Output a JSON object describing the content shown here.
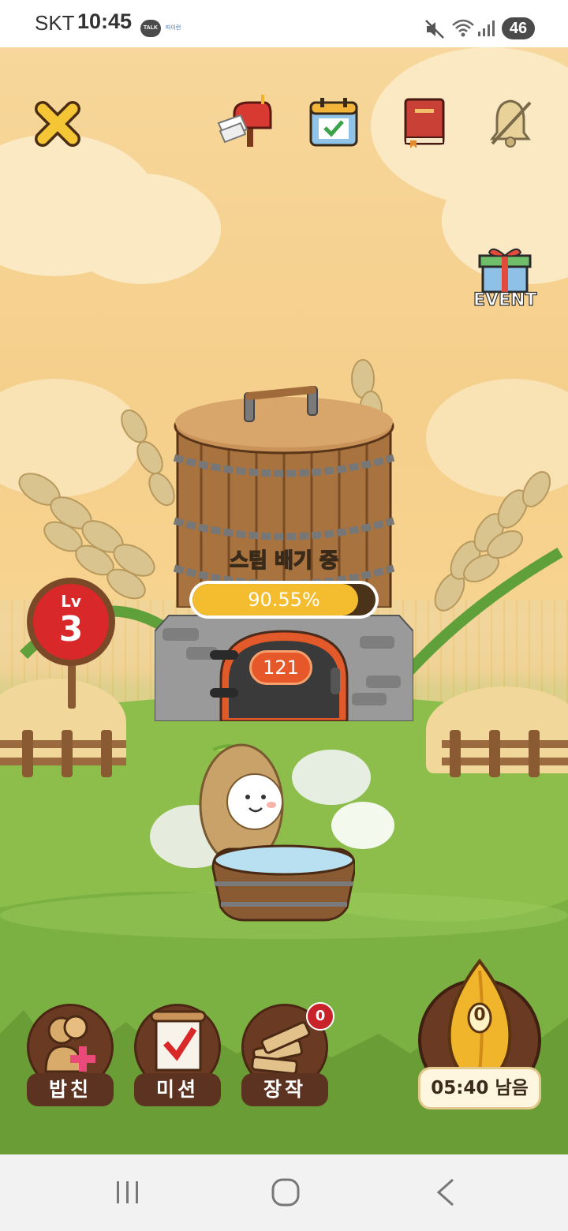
{
  "status_bar": {
    "carrier": "SKT",
    "time": "10:45",
    "talk_badge": "TALK",
    "talk_small": "따이런",
    "battery": "46"
  },
  "game": {
    "event_label": "EVENT",
    "level_prefix": "Lv",
    "level_value": "3",
    "steam_status": "스팀 배기 중",
    "progress_text": "90.55%",
    "progress_fraction": 0.9055,
    "oven_value": "121",
    "gift_badge_count": "0",
    "timer_text": "05:40 남음",
    "seed_counter": "0",
    "top_icons": [
      "close-icon",
      "mailbox-icon",
      "calendar-icon",
      "book-icon",
      "bell-muted-icon"
    ]
  },
  "menu": {
    "friends_label": "밥친",
    "mission_label": "미션",
    "firewood_label": "장작"
  },
  "colors": {
    "progress_fill": "#f4bd2f",
    "level_sign": "#d8282a",
    "menu_brown": "#5b3320"
  }
}
